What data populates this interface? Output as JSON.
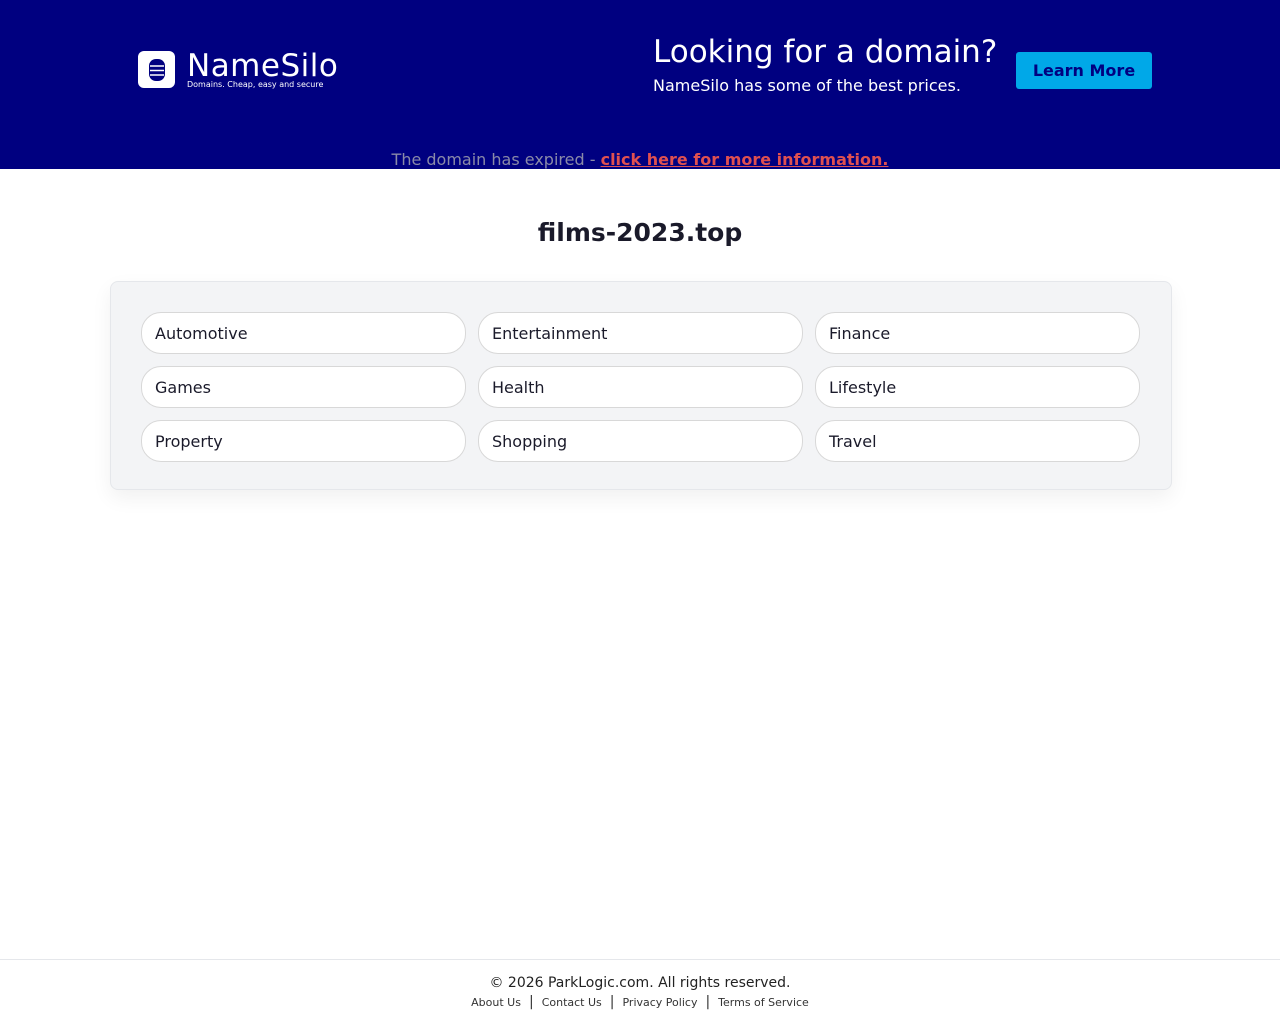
{
  "banner": {
    "brand": "NameSilo",
    "tagline": "Domains. Cheap, easy and secure",
    "headline": "Looking for a domain?",
    "subline": "NameSilo has some of the best prices.",
    "cta": "Learn More",
    "expired_text": "The domain has expired - ",
    "expired_link": "click here for more information."
  },
  "domain": "films-2023.top",
  "categories": [
    "Automotive",
    "Entertainment",
    "Finance",
    "Games",
    "Health",
    "Lifestyle",
    "Property",
    "Shopping",
    "Travel"
  ],
  "footer": {
    "copyright": "© 2026 ParkLogic.com. All rights reserved.",
    "links": [
      "About Us",
      "Contact Us",
      "Privacy Policy",
      "Terms of Service"
    ]
  }
}
